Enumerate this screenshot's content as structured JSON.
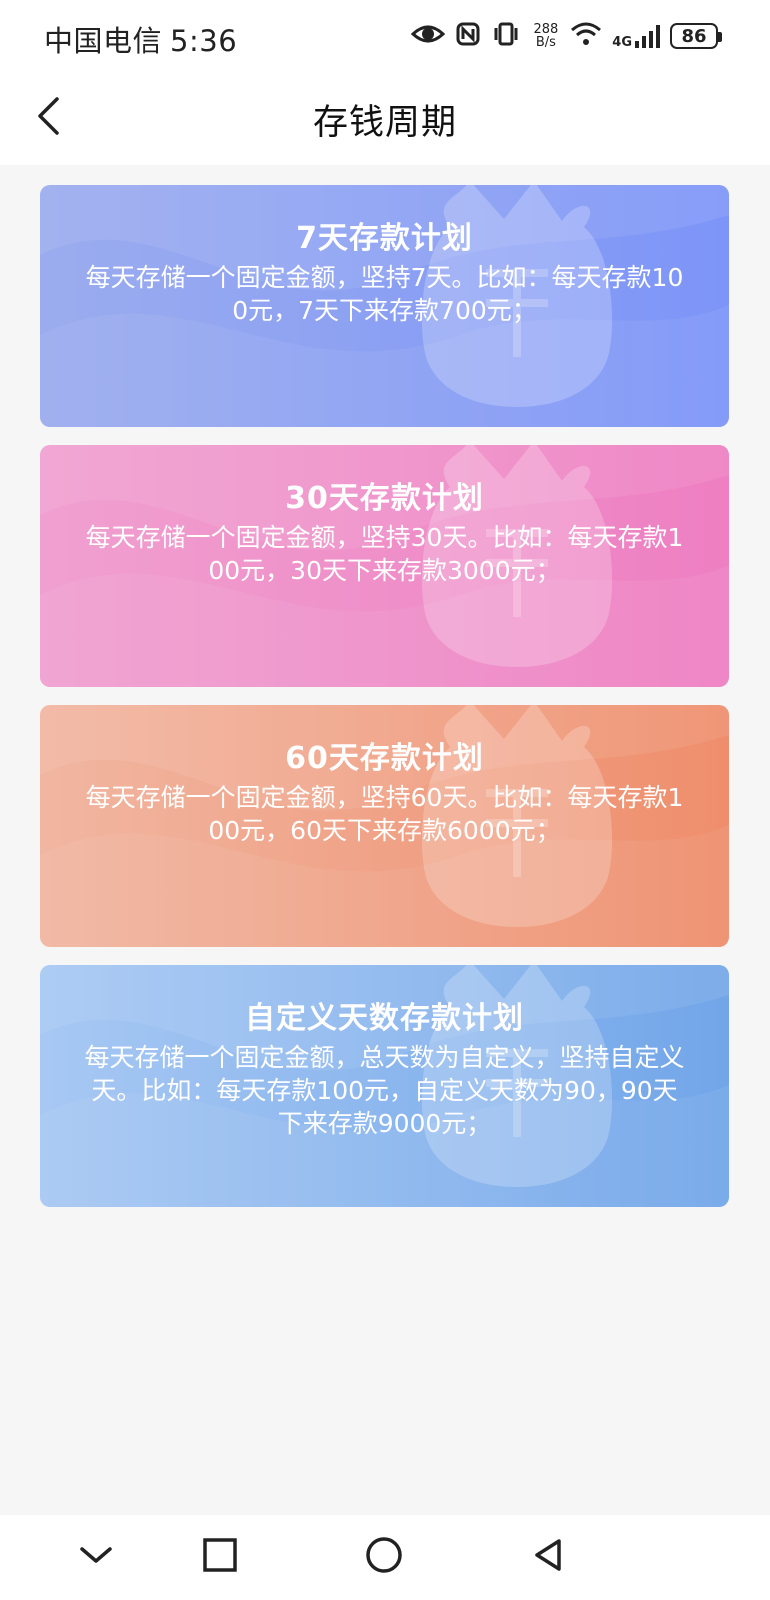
{
  "status_bar": {
    "carrier": "中国电信",
    "time": "5:36",
    "speed_value": "288",
    "speed_unit": "B/s",
    "network_type": "4G",
    "battery": "86"
  },
  "header": {
    "title": "存钱周期"
  },
  "plans": [
    {
      "title": "7天存款计划",
      "description": "每天存储一个固定金额，坚持7天。比如：每天存款100元，7天下来存款700元；",
      "colors": [
        "#9bacee",
        "#7d95f8"
      ]
    },
    {
      "title": "30天存款计划",
      "description": "每天存储一个固定金额，坚持30天。比如：每天存款100元，30天下来存款3000元；",
      "colors": [
        "#f0a0d0",
        "#ee7fc2"
      ]
    },
    {
      "title": "60天存款计划",
      "description": "每天存储一个固定金额，坚持60天。比如：每天存款100元，60天下来存款6000元；",
      "colors": [
        "#f1b6a1",
        "#ef8e6c"
      ]
    },
    {
      "title": "自定义天数存款计划",
      "description": "每天存储一个固定金额，总天数为自定义，坚持自定义天。比如：每天存款100元，自定义天数为90，90天下来存款9000元；",
      "colors": [
        "#a7c8f3",
        "#72a6e9"
      ]
    }
  ],
  "icons": {
    "back": "back-arrow-icon",
    "card_decor": "money-bag-icon",
    "nav": [
      "chevron-down-icon",
      "square-icon",
      "circle-icon",
      "triangle-back-icon"
    ]
  }
}
